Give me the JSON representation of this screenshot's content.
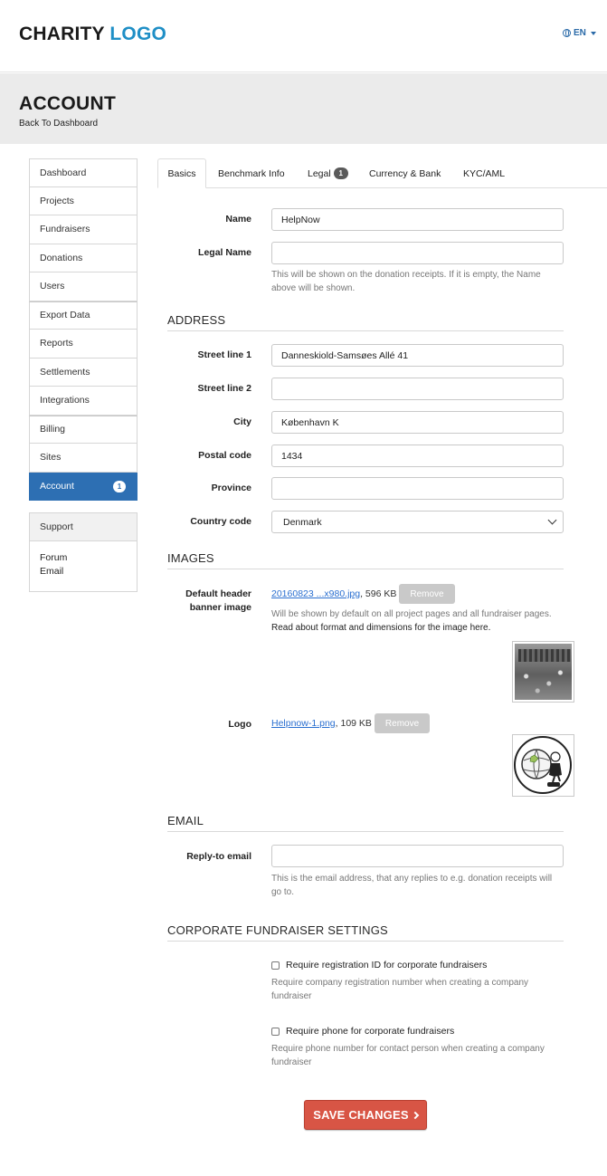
{
  "header": {
    "logo_main": "CHARITY",
    "logo_accent": "LOGO",
    "language": "EN",
    "accent_color": "#1f8fc6"
  },
  "page": {
    "title": "ACCOUNT",
    "back_link": "Back To Dashboard"
  },
  "sidebar": {
    "items": [
      {
        "label": "Dashboard"
      },
      {
        "label": "Projects"
      },
      {
        "label": "Fundraisers"
      },
      {
        "label": "Donations"
      },
      {
        "label": "Users"
      },
      {
        "label": "Export Data"
      },
      {
        "label": "Reports"
      },
      {
        "label": "Settlements"
      },
      {
        "label": "Integrations"
      },
      {
        "label": "Billing"
      },
      {
        "label": "Sites"
      },
      {
        "label": "Account",
        "badge": "1",
        "active": true
      }
    ],
    "support_title": "Support",
    "support_links": [
      "Forum",
      "Email"
    ],
    "active_color": "#2d6fb3"
  },
  "tabs": [
    {
      "label": "Basics",
      "active": true
    },
    {
      "label": "Benchmark Info"
    },
    {
      "label": "Legal",
      "badge": "1"
    },
    {
      "label": "Currency & Bank"
    },
    {
      "label": "KYC/AML"
    }
  ],
  "basics": {
    "name_label": "Name",
    "name_value": "HelpNow",
    "legal_name_label": "Legal Name",
    "legal_name_value": "",
    "legal_name_help_1": "This will be shown on the donation receipts. If it is empty, the Name",
    "legal_name_help_2": "above will be shown."
  },
  "address": {
    "section_title": "ADDRESS",
    "street1_label": "Street line 1",
    "street1_value": "Danneskiold-Samsøes Allé 41",
    "street2_label": "Street line 2",
    "street2_value": "",
    "city_label": "City",
    "city_value": "København K",
    "postal_label": "Postal code",
    "postal_value": "1434",
    "province_label": "Province",
    "province_value": "",
    "country_label": "Country code",
    "country_value": "Denmark"
  },
  "images": {
    "section_title": "IMAGES",
    "banner_label_1": "Default header",
    "banner_label_2": "banner image",
    "banner_file": "20160823 ...x980.jpg",
    "banner_size": ", 596 KB",
    "remove_label": "Remove",
    "banner_help_1": "Will be shown by default on all project pages and all fundraiser pages.",
    "banner_help_2": "Read about format and dimensions for the image here",
    "banner_help_3": ".",
    "logo_label": "Logo",
    "logo_file": "Helpnow-1.png",
    "logo_size": ", 109 KB"
  },
  "email": {
    "section_title": "EMAIL",
    "reply_label": "Reply-to email",
    "reply_value": "",
    "reply_help_1": "This is the email address, that any replies to e.g. donation receipts will",
    "reply_help_2": "go to."
  },
  "corporate": {
    "section_title": "CORPORATE FUNDRAISER SETTINGS",
    "reg_id_label": "Require registration ID for corporate fundraisers",
    "reg_id_checked": false,
    "reg_id_help_1": "Require company registration number when creating a company",
    "reg_id_help_2": "fundraiser",
    "phone_label": "Require phone for corporate fundraisers",
    "phone_checked": false,
    "phone_help_1": "Require phone number for contact person when creating a company",
    "phone_help_2": "fundraiser"
  },
  "actions": {
    "save_label": "SAVE CHANGES",
    "save_color": "#d85545"
  }
}
